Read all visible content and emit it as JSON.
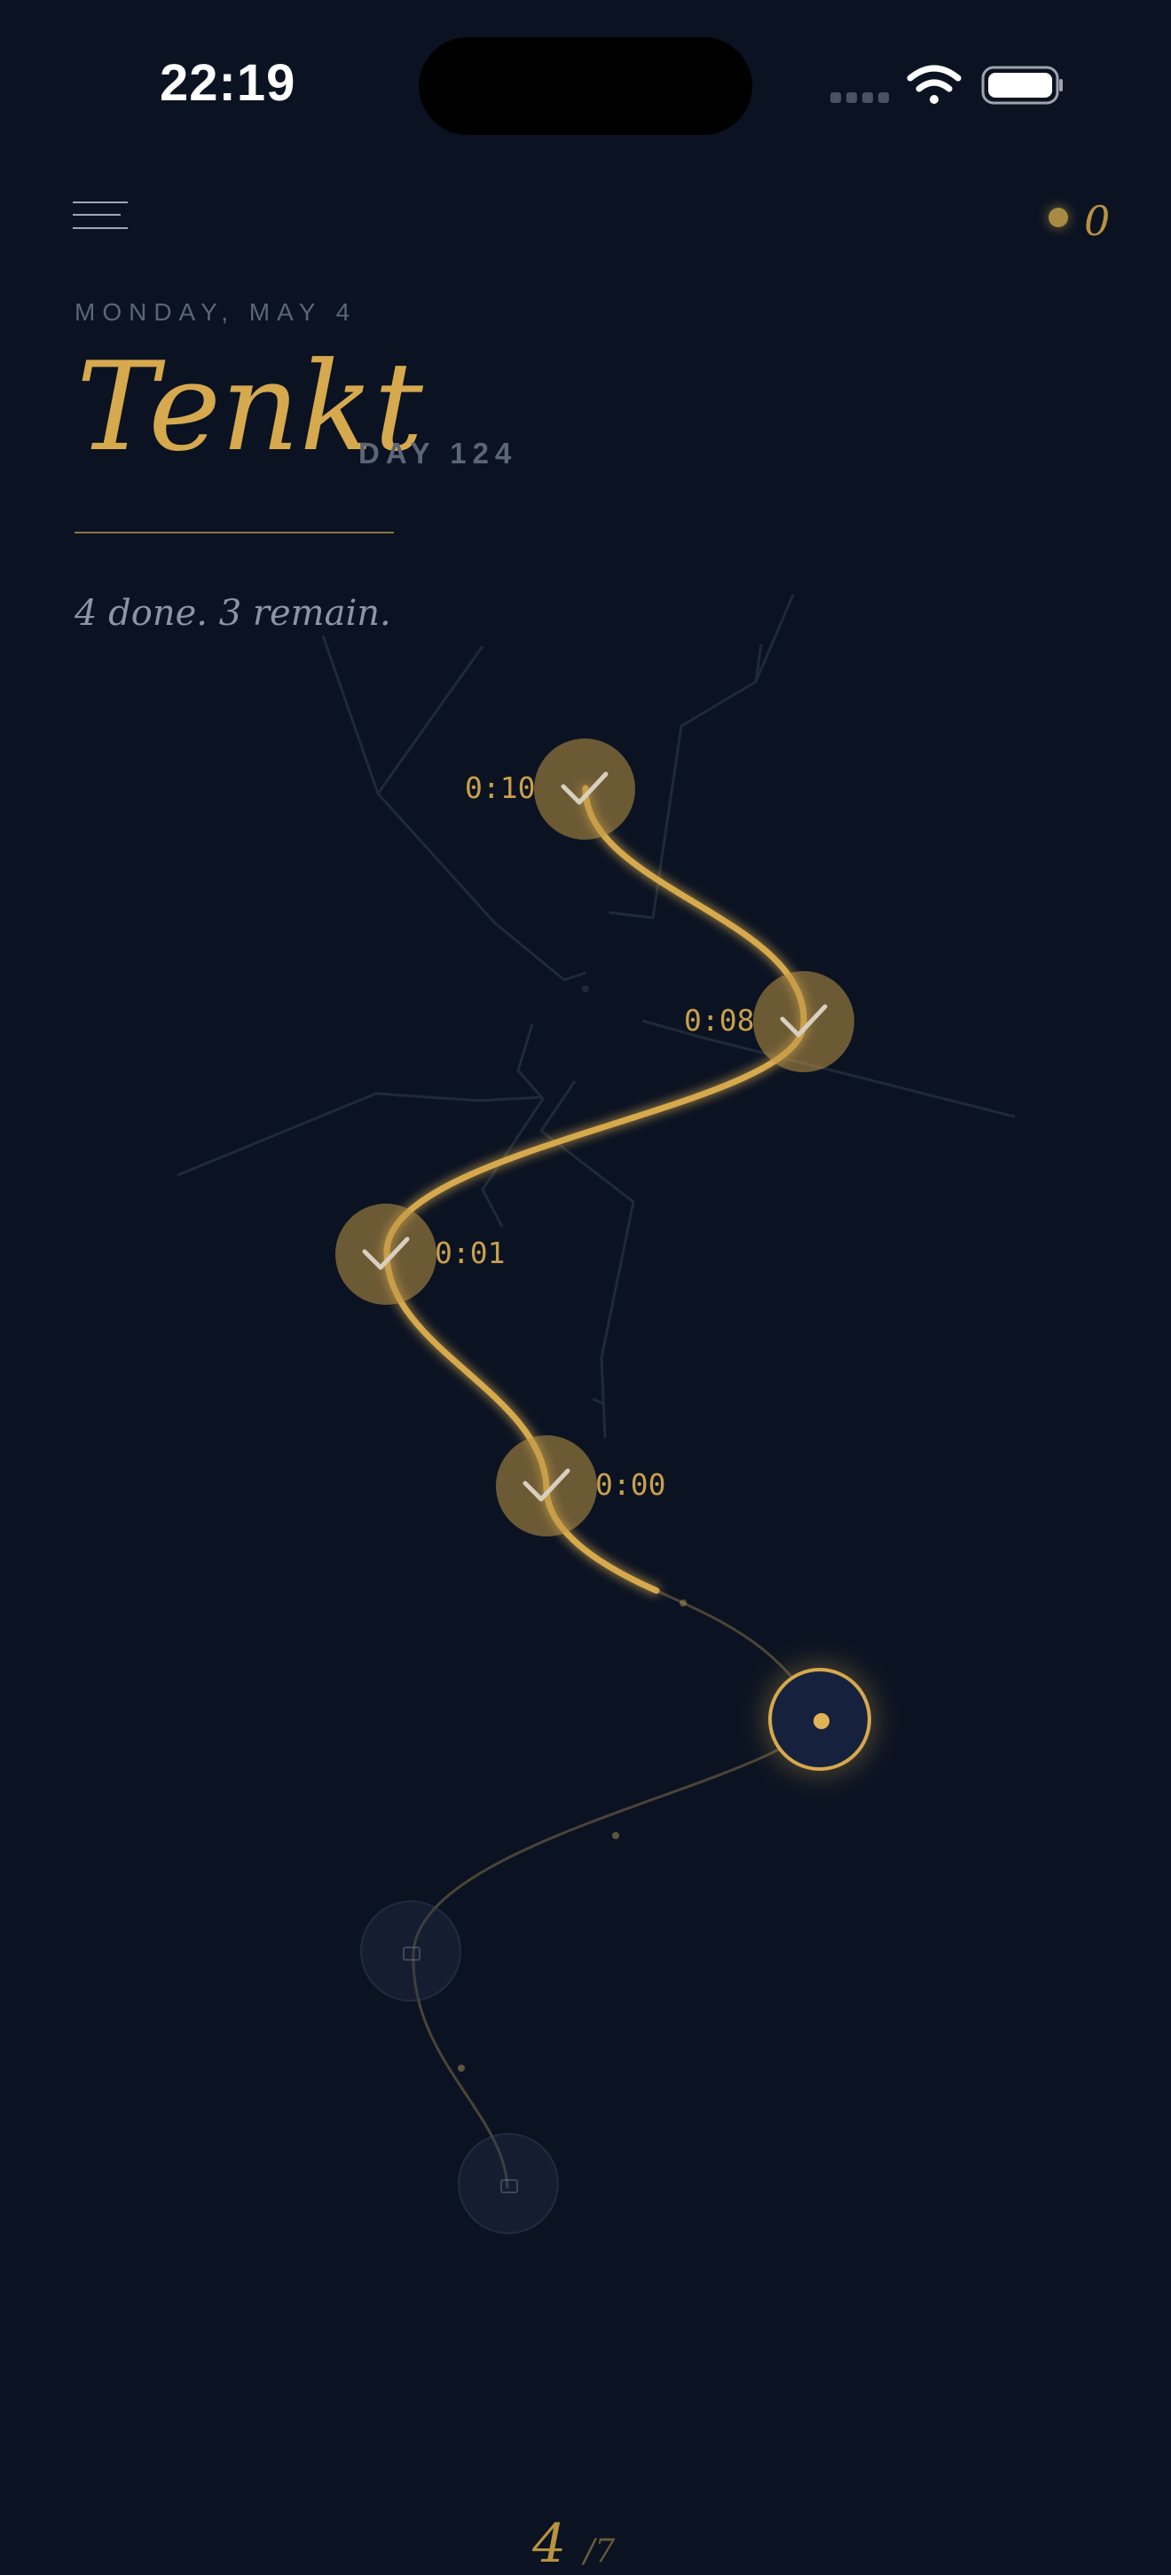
{
  "status_bar": {
    "time": "22:19",
    "icons": [
      "signal-icon",
      "wifi-icon",
      "battery-icon"
    ]
  },
  "header": {
    "menu_icon": "menu-icon",
    "streak_count": "0",
    "date": "MONDAY, MAY 4",
    "title": "Tenkt",
    "day": "DAY 124",
    "summary": "4 done. 3 remain."
  },
  "path": {
    "nodes": [
      {
        "state": "done",
        "time": "0:10",
        "icon": "checkmark-icon"
      },
      {
        "state": "done",
        "time": "0:08",
        "icon": "checkmark-icon"
      },
      {
        "state": "done",
        "time": "0:01",
        "icon": "checkmark-icon"
      },
      {
        "state": "done",
        "time": "0:00",
        "icon": "checkmark-icon"
      },
      {
        "state": "current",
        "icon": "dot-icon"
      },
      {
        "state": "locked",
        "icon": "lock-icon"
      },
      {
        "state": "locked",
        "icon": "lock-icon"
      }
    ]
  },
  "footer": {
    "value": "4",
    "total": "/7"
  },
  "colors": {
    "background": "#0b1322",
    "gold": "#d6a94e",
    "muted": "#5b6577"
  }
}
